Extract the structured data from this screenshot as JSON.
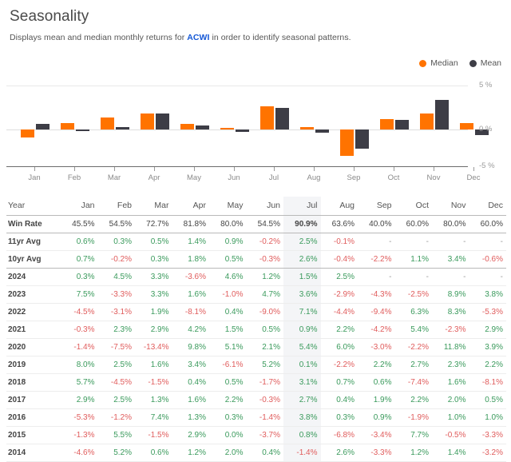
{
  "header": {
    "title": "Seasonality",
    "subtitle_before": "Displays mean and median monthly returns for ",
    "ticker": "ACWI",
    "subtitle_after": " in order to identify seasonal patterns."
  },
  "legend": {
    "items": [
      {
        "label": "Median",
        "color": "#ff7300",
        "icon": "circle-marker-icon"
      },
      {
        "label": "Mean",
        "color": "#3d3d46",
        "icon": "circle-marker-icon"
      }
    ]
  },
  "chart_data": {
    "type": "bar",
    "title": "Seasonality",
    "xlabel": "",
    "ylabel": "",
    "ylim": [
      -5,
      5
    ],
    "grid": true,
    "legend_position": "top-right",
    "ytick_labels": [
      "5 %",
      "0 %",
      "-5 %"
    ],
    "ytick_values": [
      5,
      0,
      -5
    ],
    "categories": [
      "Jan",
      "Feb",
      "Mar",
      "Apr",
      "May",
      "Jun",
      "Jul",
      "Aug",
      "Sep",
      "Oct",
      "Nov",
      "Dec"
    ],
    "series": [
      {
        "name": "Median",
        "color": "#ff7300",
        "values": [
          -0.9,
          0.7,
          1.4,
          1.8,
          0.6,
          0.2,
          2.6,
          0.3,
          -3.0,
          1.2,
          1.8,
          0.7
        ]
      },
      {
        "name": "Mean",
        "color": "#3d3d46",
        "values": [
          0.6,
          -0.2,
          0.3,
          1.8,
          0.5,
          -0.3,
          2.5,
          -0.4,
          -2.2,
          1.1,
          3.4,
          -0.6
        ]
      }
    ]
  },
  "table": {
    "columns": [
      "Year",
      "Jan",
      "Feb",
      "Mar",
      "Apr",
      "May",
      "Jun",
      "Jul",
      "Aug",
      "Sep",
      "Oct",
      "Nov",
      "Dec"
    ],
    "highlight_column": "Jul",
    "rows": [
      {
        "label": "Win Rate",
        "type": "winrate",
        "values": [
          "45.5%",
          "54.5%",
          "72.7%",
          "81.8%",
          "80.0%",
          "54.5%",
          "90.9%",
          "63.6%",
          "40.0%",
          "60.0%",
          "80.0%",
          "60.0%"
        ]
      },
      {
        "label": "11yr Avg",
        "type": "avg",
        "values": [
          "0.6%",
          "0.3%",
          "0.5%",
          "1.4%",
          "0.9%",
          "-0.2%",
          "2.5%",
          "-0.1%",
          "-",
          "-",
          "-",
          "-"
        ]
      },
      {
        "label": "10yr Avg",
        "type": "avg",
        "values": [
          "0.7%",
          "-0.2%",
          "0.3%",
          "1.8%",
          "0.5%",
          "-0.3%",
          "2.6%",
          "-0.4%",
          "-2.2%",
          "1.1%",
          "3.4%",
          "-0.6%"
        ]
      },
      {
        "label": "2024",
        "type": "year",
        "values": [
          "0.3%",
          "4.5%",
          "3.3%",
          "-3.6%",
          "4.6%",
          "1.2%",
          "1.5%",
          "2.5%",
          "-",
          "-",
          "-",
          "-"
        ]
      },
      {
        "label": "2023",
        "type": "year",
        "values": [
          "7.5%",
          "-3.3%",
          "3.3%",
          "1.6%",
          "-1.0%",
          "4.7%",
          "3.6%",
          "-2.9%",
          "-4.3%",
          "-2.5%",
          "8.9%",
          "3.8%"
        ]
      },
      {
        "label": "2022",
        "type": "year",
        "values": [
          "-4.5%",
          "-3.1%",
          "1.9%",
          "-8.1%",
          "0.4%",
          "-9.0%",
          "7.1%",
          "-4.4%",
          "-9.4%",
          "6.3%",
          "8.3%",
          "-5.3%"
        ]
      },
      {
        "label": "2021",
        "type": "year",
        "values": [
          "-0.3%",
          "2.3%",
          "2.9%",
          "4.2%",
          "1.5%",
          "0.5%",
          "0.9%",
          "2.2%",
          "-4.2%",
          "5.4%",
          "-2.3%",
          "2.9%"
        ]
      },
      {
        "label": "2020",
        "type": "year",
        "values": [
          "-1.4%",
          "-7.5%",
          "-13.4%",
          "9.8%",
          "5.1%",
          "2.1%",
          "5.4%",
          "6.0%",
          "-3.0%",
          "-2.2%",
          "11.8%",
          "3.9%"
        ]
      },
      {
        "label": "2019",
        "type": "year",
        "values": [
          "8.0%",
          "2.5%",
          "1.6%",
          "3.4%",
          "-6.1%",
          "5.2%",
          "0.1%",
          "-2.2%",
          "2.2%",
          "2.7%",
          "2.3%",
          "2.2%"
        ]
      },
      {
        "label": "2018",
        "type": "year",
        "values": [
          "5.7%",
          "-4.5%",
          "-1.5%",
          "0.4%",
          "0.5%",
          "-1.7%",
          "3.1%",
          "0.7%",
          "0.6%",
          "-7.4%",
          "1.6%",
          "-8.1%"
        ]
      },
      {
        "label": "2017",
        "type": "year",
        "values": [
          "2.9%",
          "2.5%",
          "1.3%",
          "1.6%",
          "2.2%",
          "-0.3%",
          "2.7%",
          "0.4%",
          "1.9%",
          "2.2%",
          "2.0%",
          "0.5%"
        ]
      },
      {
        "label": "2016",
        "type": "year",
        "values": [
          "-5.3%",
          "-1.2%",
          "7.4%",
          "1.3%",
          "0.3%",
          "-1.4%",
          "3.8%",
          "0.3%",
          "0.9%",
          "-1.9%",
          "1.0%",
          "1.0%"
        ]
      },
      {
        "label": "2015",
        "type": "year",
        "values": [
          "-1.3%",
          "5.5%",
          "-1.5%",
          "2.9%",
          "0.0%",
          "-3.7%",
          "0.8%",
          "-6.8%",
          "-3.4%",
          "7.7%",
          "-0.5%",
          "-3.3%"
        ]
      },
      {
        "label": "2014",
        "type": "year",
        "values": [
          "-4.6%",
          "5.2%",
          "0.6%",
          "1.2%",
          "2.0%",
          "0.4%",
          "-1.4%",
          "2.6%",
          "-3.3%",
          "1.2%",
          "1.4%",
          "-3.2%"
        ]
      }
    ]
  }
}
